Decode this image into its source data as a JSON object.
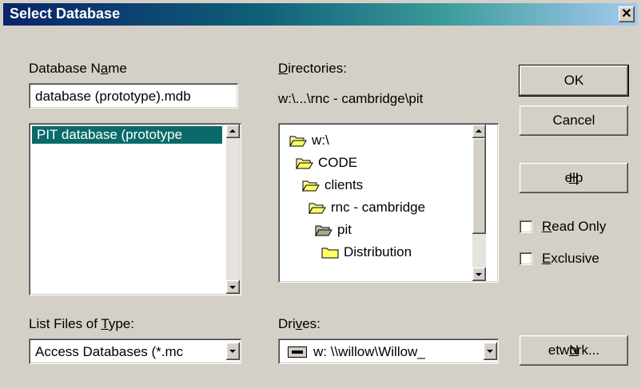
{
  "window": {
    "title": "Select Database",
    "close_glyph": "✕"
  },
  "db_name": {
    "label_pre": "Database N",
    "label_u": "a",
    "label_post": "me",
    "value": "database (prototype).mdb",
    "files": [
      "PIT database (prototype"
    ]
  },
  "dirs": {
    "label_u": "D",
    "label_post": "irectories:",
    "current_path": "w:\\...\\rnc - cambridge\\pit",
    "items": [
      "w:\\",
      "CODE",
      "clients",
      "rnc - cambridge",
      "pit",
      "Distribution"
    ]
  },
  "file_type": {
    "label_pre": "List Files of ",
    "label_u": "T",
    "label_post": "ype:",
    "value": "Access Databases (*.mc"
  },
  "drives": {
    "label_pre": "Dri",
    "label_u": "v",
    "label_post": "es:",
    "value": "w: \\\\willow\\Willow_"
  },
  "buttons": {
    "ok": "OK",
    "cancel": "Cancel",
    "help_u": "H",
    "help_post": "elp",
    "network_u": "N",
    "network_post": "etwork..."
  },
  "options": {
    "read_only_u": "R",
    "read_only_post": "ead Only",
    "exclusive_u": "E",
    "exclusive_post": "xclusive"
  }
}
